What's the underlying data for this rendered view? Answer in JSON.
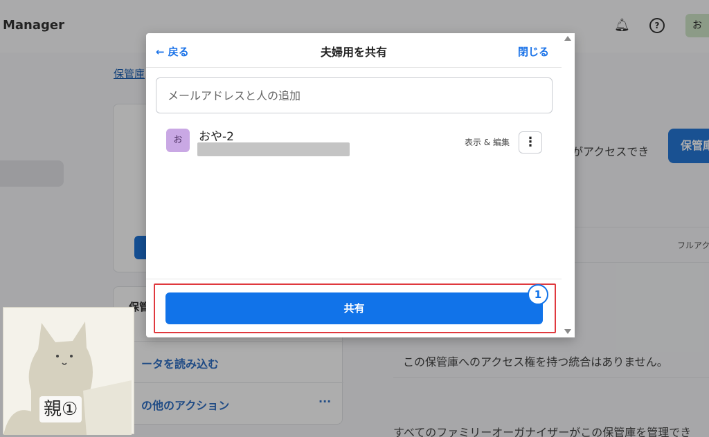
{
  "background": {
    "app_title": "Manager",
    "avatar_initial": "お",
    "breadcrumb": "保管庫",
    "card2_title": "保管",
    "import_label": "ータを読み込む",
    "other_actions_label": "の他のアクション",
    "more_label": "···",
    "access_text": "がアクセスでき",
    "share_button_partial": "保管庫",
    "full_access_partial": "フルアク",
    "no_integration_text": "この保管庫へのアクセス権を持つ統合はありません。",
    "family_text": "すべてのファミリーオーガナイザーがこの保管庫を管理でき"
  },
  "modal": {
    "back_label": "← 戻る",
    "title": "夫婦用を共有",
    "close_label": "閉じる",
    "email_placeholder": "メールアドレスと人の追加",
    "members": [
      {
        "initial": "お",
        "name": "おや-2",
        "permission": "表示 & 編集",
        "menu_icon": "⋮"
      }
    ],
    "share_button_label": "共有",
    "step_number": "1"
  },
  "overlay_label": "親①",
  "colors": {
    "accent": "#1173e9",
    "highlight": "#e0393e",
    "avatar_bg": "#c9a8e4"
  }
}
